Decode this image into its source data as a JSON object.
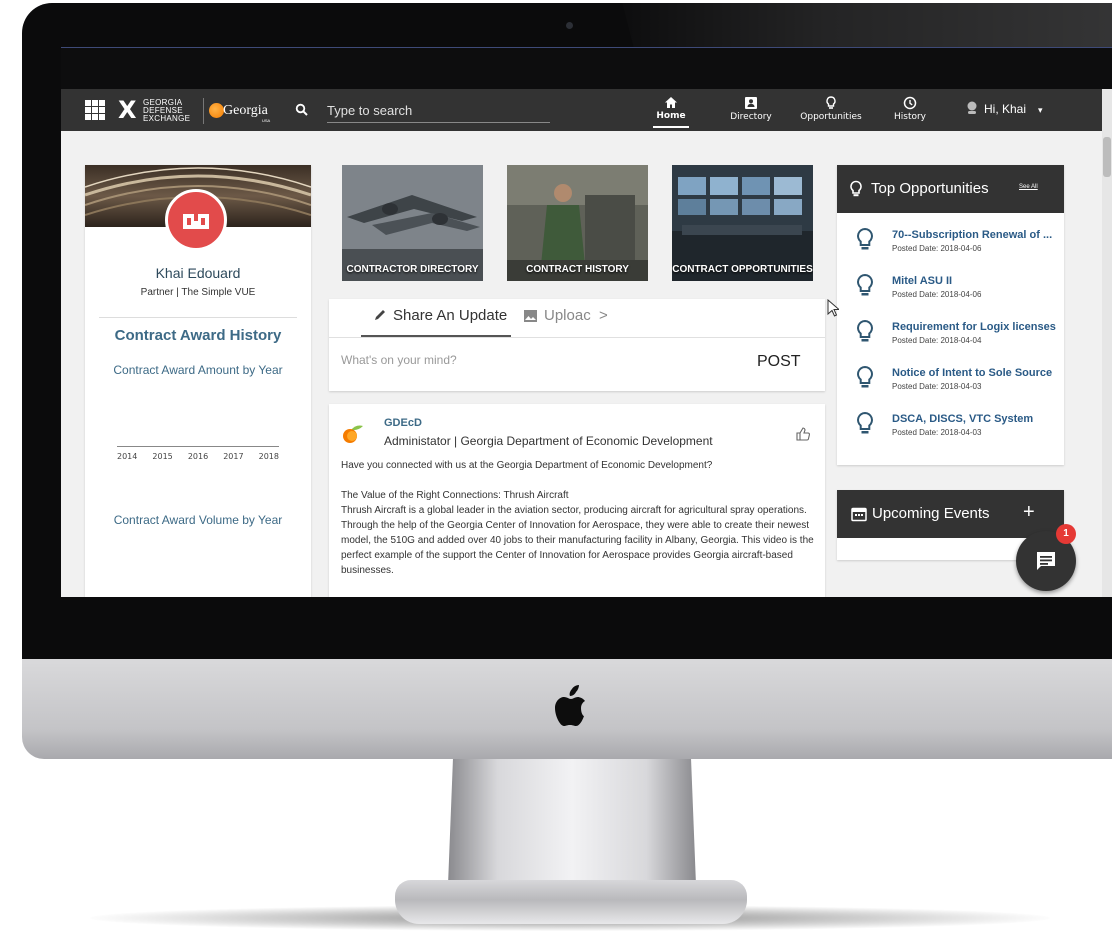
{
  "navbar": {
    "logo_lines": [
      "GEORGIA",
      "DEFENSE",
      "EXCHANGE"
    ],
    "partner_logo": "Georgia",
    "partner_logo_sub": "USA",
    "search_placeholder": "Type to search",
    "items": [
      {
        "label": "Home",
        "icon": "home-icon"
      },
      {
        "label": "Directory",
        "icon": "directory-icon"
      },
      {
        "label": "Opportunities",
        "icon": "lightbulb-icon"
      },
      {
        "label": "History",
        "icon": "clock-icon"
      }
    ],
    "user_greeting": "Hi, Khai"
  },
  "profile": {
    "name": "Khai Edouard",
    "role": "Partner | The Simple VUE",
    "section_title": "Contract Award History",
    "amount_chart_title": "Contract Award Amount by Year",
    "volume_chart_title": "Contract Award Volume by Year",
    "years": [
      "2014",
      "2015",
      "2016",
      "2017",
      "2018"
    ]
  },
  "tiles": [
    {
      "label": "CONTRACTOR DIRECTORY"
    },
    {
      "label": "CONTRACT HISTORY"
    },
    {
      "label": "CONTRACT OPPORTUNITIES"
    }
  ],
  "share": {
    "tab_share": "Share An Update",
    "tab_upload": "Uploac",
    "tab_more": ">",
    "placeholder": "What's on your mind?",
    "post_label": "POST"
  },
  "post": {
    "author": "GDEcD",
    "role": "Administator | Georgia Department of Economic Development",
    "intro": "Have you connected with us at the Georgia Department of Economic Development?",
    "headline": "The Value of the Right Connections: Thrush Aircraft",
    "body": "Thrush Aircraft is a global leader in the aviation sector, producing aircraft for agricultural spray operations. Through the help of the Georgia Center of Innovation for Aerospace, they were able to create their newest model, the 510G and added over 40 jobs to their manufacturing facility in Albany, Georgia. This video is the perfect example of the support the Center of Innovation for Aerospace provides Georgia aircraft-based businesses."
  },
  "opportunities": {
    "title": "Top Opportunities",
    "see_all": "See All",
    "items": [
      {
        "name": "70--Subscription Renewal of ...",
        "date": "Posted Date: 2018-04-06"
      },
      {
        "name": "Mitel ASU II",
        "date": "Posted Date: 2018-04-06"
      },
      {
        "name": "Requirement for Logix licenses",
        "date": "Posted Date: 2018-04-04"
      },
      {
        "name": "Notice of Intent to Sole Source",
        "date": "Posted Date: 2018-04-03"
      },
      {
        "name": "DSCA, DISCS, VTC System",
        "date": "Posted Date: 2018-04-03"
      }
    ]
  },
  "events": {
    "title": "Upcoming Events",
    "add_label": "+"
  },
  "chat": {
    "badge_count": "1"
  },
  "colors": {
    "navbar": "#333333",
    "link_blue": "#3d6a86",
    "accent_red": "#e24b4b",
    "badge_red": "#e53935"
  }
}
